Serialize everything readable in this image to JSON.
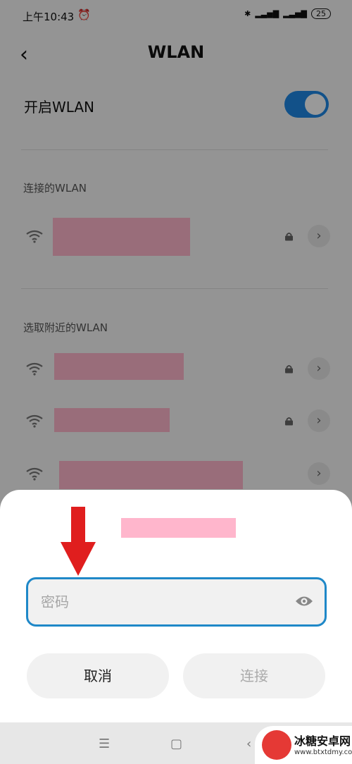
{
  "status_bar": {
    "time": "上午10:43",
    "battery": "25"
  },
  "header": {
    "title": "WLAN"
  },
  "wlan_toggle": {
    "label": "开启WLAN",
    "state": "on"
  },
  "sections": {
    "connected": "连接的WLAN",
    "nearby": "选取附近的WLAN"
  },
  "dialog": {
    "password_placeholder": "密码",
    "cancel_label": "取消",
    "connect_label": "连接"
  },
  "watermark": {
    "title": "冰糖安卓网",
    "url": "www.btxtdmy.com"
  },
  "colors": {
    "accent": "#1e88e5",
    "arrow": "#e01e1e",
    "redacted": "#ffb6cc"
  }
}
